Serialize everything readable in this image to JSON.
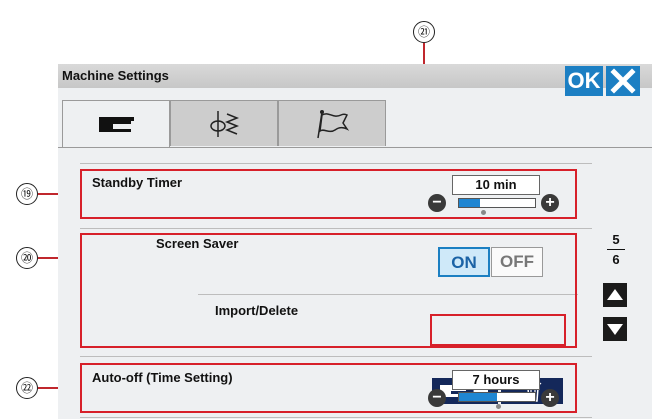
{
  "window": {
    "title": "Machine Settings",
    "ok_label": "OK"
  },
  "tabs": [
    {
      "icon": "machine-icon"
    },
    {
      "icon": "stitch-needle-icon"
    },
    {
      "icon": "flag-icon"
    }
  ],
  "standby_timer": {
    "label": "Standby Timer",
    "value": "10 min",
    "level": 0.27
  },
  "screen_saver": {
    "label": "Screen Saver",
    "on_label": "ON",
    "off_label": "OFF",
    "state": "ON"
  },
  "import_delete": {
    "label": "Import/Delete"
  },
  "auto_off": {
    "label": "Auto-off (Time Setting)",
    "value": "7 hours",
    "level": 0.5
  },
  "pagination": {
    "current": "5",
    "total": "6"
  },
  "callouts": {
    "c19": "⑲",
    "c20": "⑳",
    "c21": "㉑",
    "c22": "㉒"
  },
  "colors": {
    "accent": "#1c7fc3",
    "callout": "#d7202a",
    "dark_button": "#14285a"
  }
}
